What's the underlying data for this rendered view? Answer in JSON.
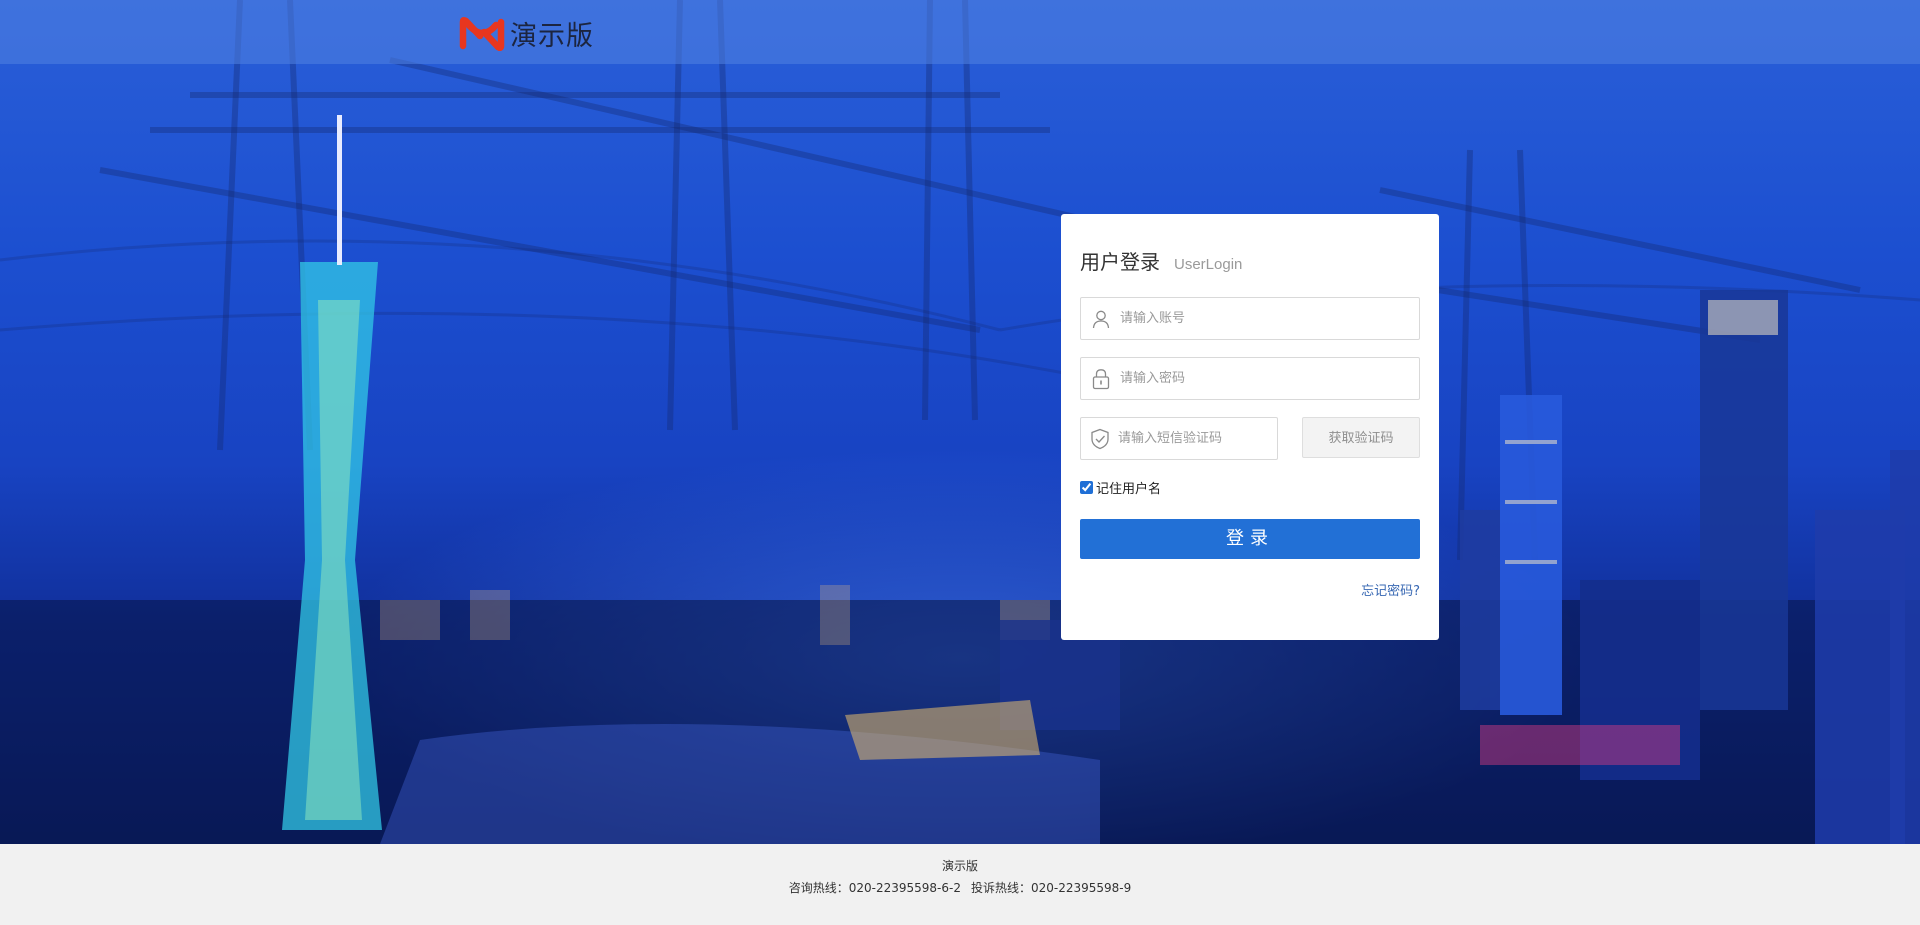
{
  "header": {
    "brand_name": "演示版",
    "logo_icon": "brand-logo-icon",
    "logo_color": "#e8361f"
  },
  "login": {
    "title": "用户登录",
    "subtitle": "UserLogin",
    "username_placeholder": "请输入账号",
    "password_placeholder": "请输入密码",
    "sms_placeholder": "请输入短信验证码",
    "sms_button": "获取验证码",
    "remember_label": "记住用户名",
    "remember_checked": true,
    "submit_label": "登录",
    "forgot_label": "忘记密码?",
    "icons": {
      "username": "user-icon",
      "password": "lock-icon",
      "sms": "shield-check-icon"
    },
    "accent_color": "#2270d6"
  },
  "footer": {
    "brand_name": "演示版",
    "consult_hotline": "咨询热线：020-22395598-6-2",
    "complaint_hotline": "投诉热线：020-22395598-9"
  }
}
